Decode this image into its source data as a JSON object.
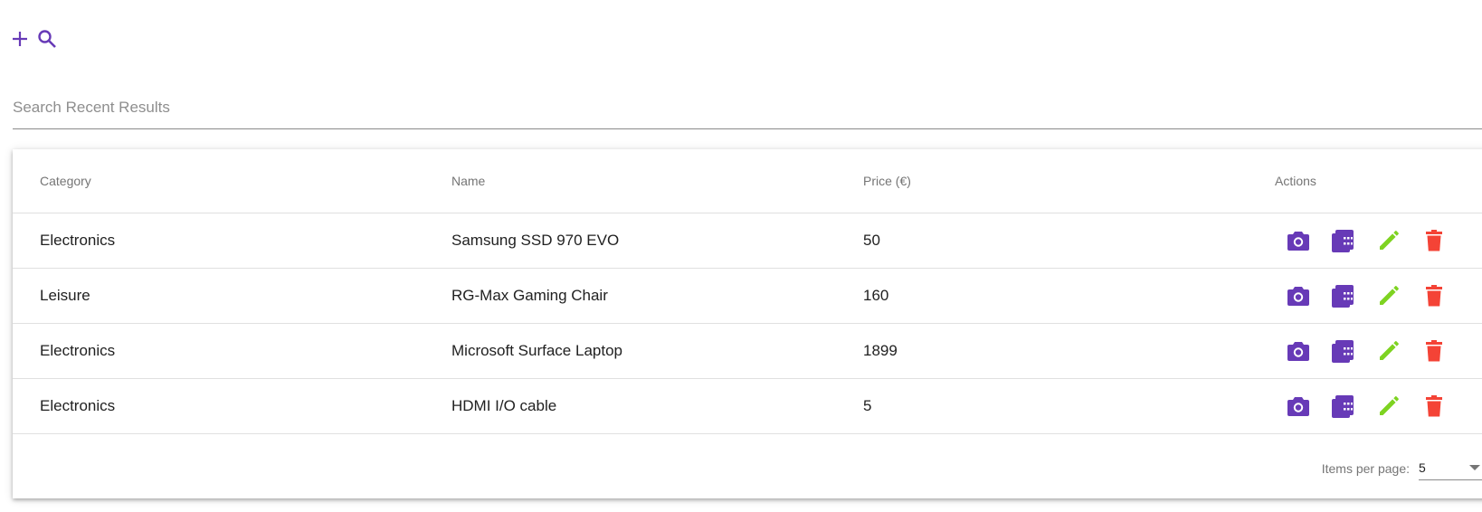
{
  "toolbar": {
    "add_icon": "plus-icon",
    "search_icon": "magnify-icon",
    "accent": "#673ab7"
  },
  "search": {
    "placeholder": "Search Recent Results",
    "value": ""
  },
  "table": {
    "headers": [
      "Category",
      "Name",
      "Price (€)",
      "Actions"
    ],
    "rows": [
      {
        "category": "Electronics",
        "name": "Samsung SSD 970 EVO",
        "price": "50"
      },
      {
        "category": "Leisure",
        "name": "RG-Max Gaming Chair",
        "price": "160"
      },
      {
        "category": "Electronics",
        "name": "Microsoft Surface Laptop",
        "price": "1899"
      },
      {
        "category": "Electronics",
        "name": "HDMI I/O cable",
        "price": "5"
      }
    ],
    "action_icons": [
      "camera-icon",
      "film-icon",
      "pencil-icon",
      "trash-icon"
    ],
    "action_colors": {
      "camera": "#673ab7",
      "film": "#673ab7",
      "edit": "#7ed321",
      "delete": "#f44336"
    }
  },
  "paginator": {
    "label": "Items per page:",
    "value": "5"
  }
}
